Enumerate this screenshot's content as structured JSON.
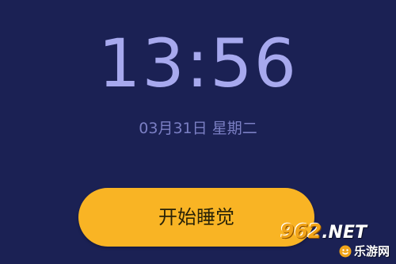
{
  "clock": {
    "time": "13:56",
    "date": "03月31日 星期二"
  },
  "actions": {
    "start_sleep_label": "开始睡觉"
  },
  "watermark": {
    "number": "962",
    "domain": ".NET",
    "site_name": "乐游网"
  },
  "colors": {
    "background": "#1b2154",
    "time_text": "#a7a9ee",
    "date_text": "#7b7fc4",
    "button": "#f9b424"
  }
}
